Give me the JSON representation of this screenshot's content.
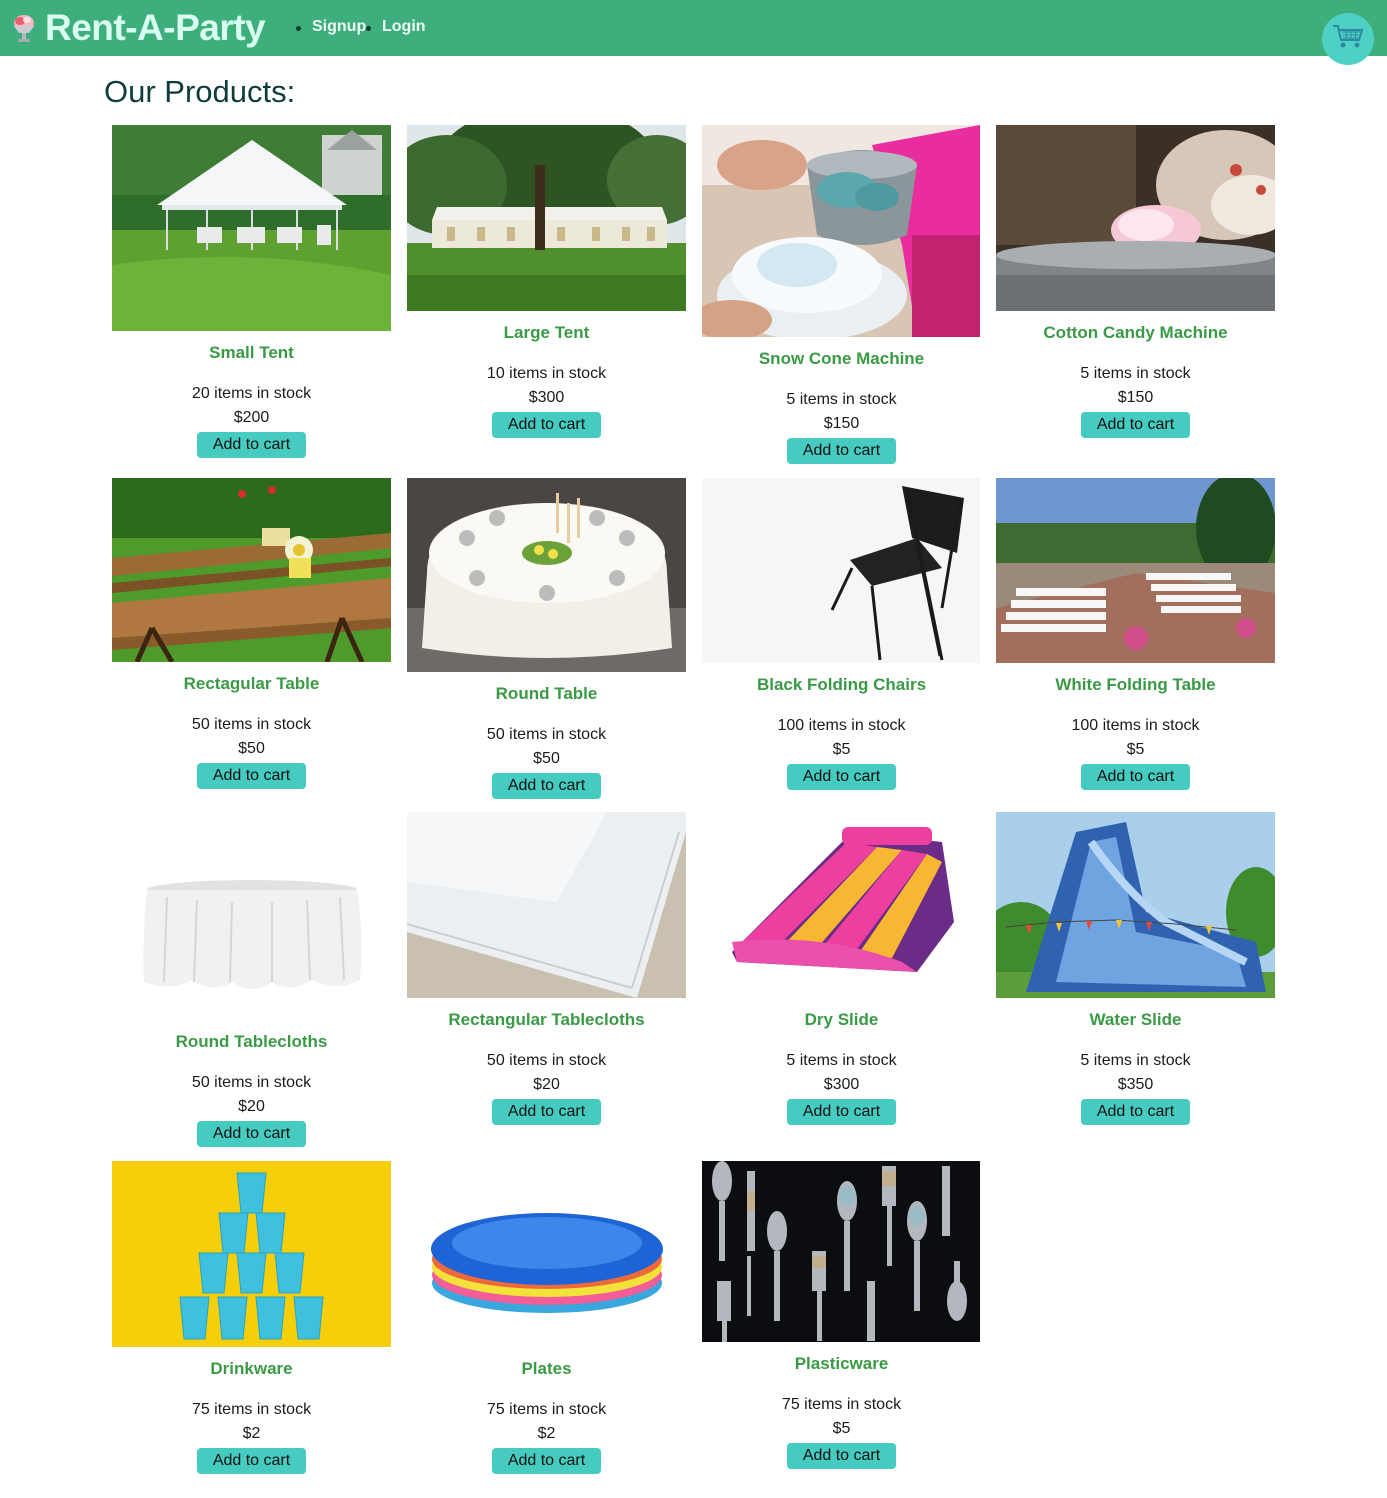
{
  "header": {
    "brand": "Rent-A-Party",
    "nav": [
      {
        "label": "Signup"
      },
      {
        "label": "Login"
      }
    ],
    "cart_icon": "shopping-cart-icon",
    "logo_icon": "snow-cone-icon"
  },
  "colors": {
    "header_bg": "#3eaf7c",
    "product_name": "#3a9a45",
    "button_bg": "#45cbc0",
    "cart_bg": "#4fd0c4"
  },
  "page_title": "Our Products:",
  "products": [
    {
      "name": "Small Tent",
      "stock": "20 items in stock",
      "price": "$200",
      "button": "Add to cart",
      "image": "white-tent-on-lawn"
    },
    {
      "name": "Large Tent",
      "stock": "10 items in stock",
      "price": "$300",
      "button": "Add to cart",
      "image": "large-marquee-tent"
    },
    {
      "name": "Snow Cone Machine",
      "stock": "5 items in stock",
      "price": "$150",
      "button": "Add to cart",
      "image": "shaved-ice-bowl"
    },
    {
      "name": "Cotton Candy Machine",
      "stock": "5 items in stock",
      "price": "$150",
      "button": "Add to cart",
      "image": "cotton-candy-spinner"
    },
    {
      "name": "Rectagular Table",
      "stock": "50 items in stock",
      "price": "$50",
      "button": "Add to cart",
      "image": "wooden-picnic-tables"
    },
    {
      "name": "Round Table",
      "stock": "50 items in stock",
      "price": "$50",
      "button": "Add to cart",
      "image": "set-round-table"
    },
    {
      "name": "Black Folding Chairs",
      "stock": "100 items in stock",
      "price": "$5",
      "button": "Add to cart",
      "image": "black-folding-chair"
    },
    {
      "name": "White Folding Table",
      "stock": "100 items in stock",
      "price": "$5",
      "button": "Add to cart",
      "image": "white-chairs-on-patio"
    },
    {
      "name": "Round Tablecloths",
      "stock": "50 items in stock",
      "price": "$20",
      "button": "Add to cart",
      "image": "white-round-tablecloth"
    },
    {
      "name": "Rectangular Tablecloths",
      "stock": "50 items in stock",
      "price": "$20",
      "button": "Add to cart",
      "image": "white-linen-corner"
    },
    {
      "name": "Dry Slide",
      "stock": "5 items in stock",
      "price": "$300",
      "button": "Add to cart",
      "image": "inflatable-dry-slide"
    },
    {
      "name": "Water Slide",
      "stock": "5 items in stock",
      "price": "$350",
      "button": "Add to cart",
      "image": "inflatable-water-slide"
    },
    {
      "name": "Drinkware",
      "stock": "75 items in stock",
      "price": "$2",
      "button": "Add to cart",
      "image": "blue-cups-pyramid"
    },
    {
      "name": "Plates",
      "stock": "75 items in stock",
      "price": "$2",
      "button": "Add to cart",
      "image": "stacked-plastic-plates"
    },
    {
      "name": "Plasticware",
      "stock": "75 items in stock",
      "price": "$5",
      "button": "Add to cart",
      "image": "plastic-cutlery"
    }
  ]
}
